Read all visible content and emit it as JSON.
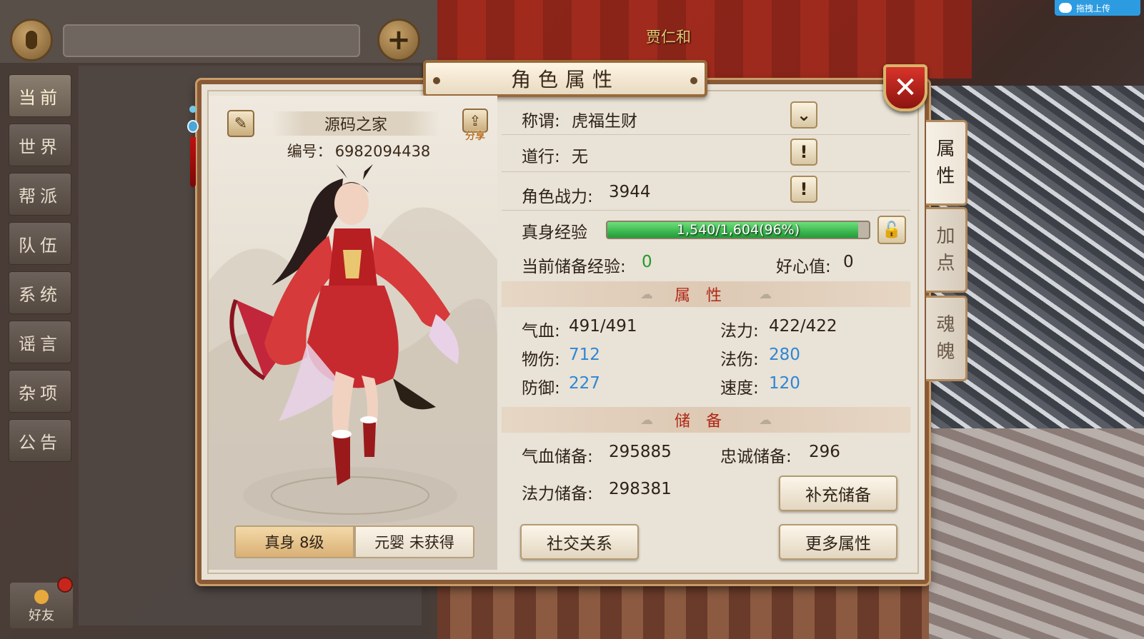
{
  "world": {
    "npc_name": "贾仁和",
    "upload_label": "拖拽上传"
  },
  "chat": {
    "channels": [
      "当前",
      "世界",
      "帮派",
      "队伍",
      "系统",
      "谣言",
      "杂项",
      "公告"
    ],
    "friend_label": "好友"
  },
  "dialog": {
    "title": "角色属性",
    "close_glyph": "✕"
  },
  "character": {
    "name": "源码之家",
    "id_label": "编号：",
    "id_value": "6982094438",
    "share_label": "分享",
    "level_tabs": [
      {
        "label": "真身 8级",
        "active": true
      },
      {
        "label": "元婴 未获得",
        "active": false
      }
    ]
  },
  "info": {
    "title_label": "称谓:",
    "title_value": "虎福生财",
    "dao_label": "道行:",
    "dao_value": "无",
    "power_label": "角色战力:",
    "power_value": "3944",
    "exp_label": "真身经验",
    "exp_text": "1,540/1,604(96%)",
    "exp_fraction": 0.96,
    "stored_exp_label": "当前储备经验:",
    "stored_exp_value": "0",
    "kindness_label": "好心值:",
    "kindness_value": "0"
  },
  "attributes": {
    "section_label": "属性",
    "hp_label": "气血:",
    "hp_value": "491/491",
    "mp_label": "法力:",
    "mp_value": "422/422",
    "phy_atk_label": "物伤:",
    "phy_atk_value": "712",
    "mag_atk_label": "法伤:",
    "mag_atk_value": "280",
    "def_label": "防御:",
    "def_value": "227",
    "speed_label": "速度:",
    "speed_value": "120"
  },
  "reserve": {
    "section_label": "储备",
    "hp_reserve_label": "气血储备:",
    "hp_reserve_value": "295885",
    "loyalty_reserve_label": "忠诚储备:",
    "loyalty_reserve_value": "296",
    "mp_reserve_label": "法力储备:",
    "mp_reserve_value": "298381",
    "refill_button": "补充储备"
  },
  "buttons": {
    "social": "社交关系",
    "more_attrs": "更多属性"
  },
  "side_tabs": [
    {
      "label": "属性",
      "active": true
    },
    {
      "label": "加点",
      "active": false
    },
    {
      "label": "魂魄",
      "active": false
    }
  ],
  "colors": {
    "accent_red": "#b02818",
    "value_blue": "#2d86d6",
    "value_green": "#1f9a2a",
    "exp_bar": "#1f9c36"
  }
}
